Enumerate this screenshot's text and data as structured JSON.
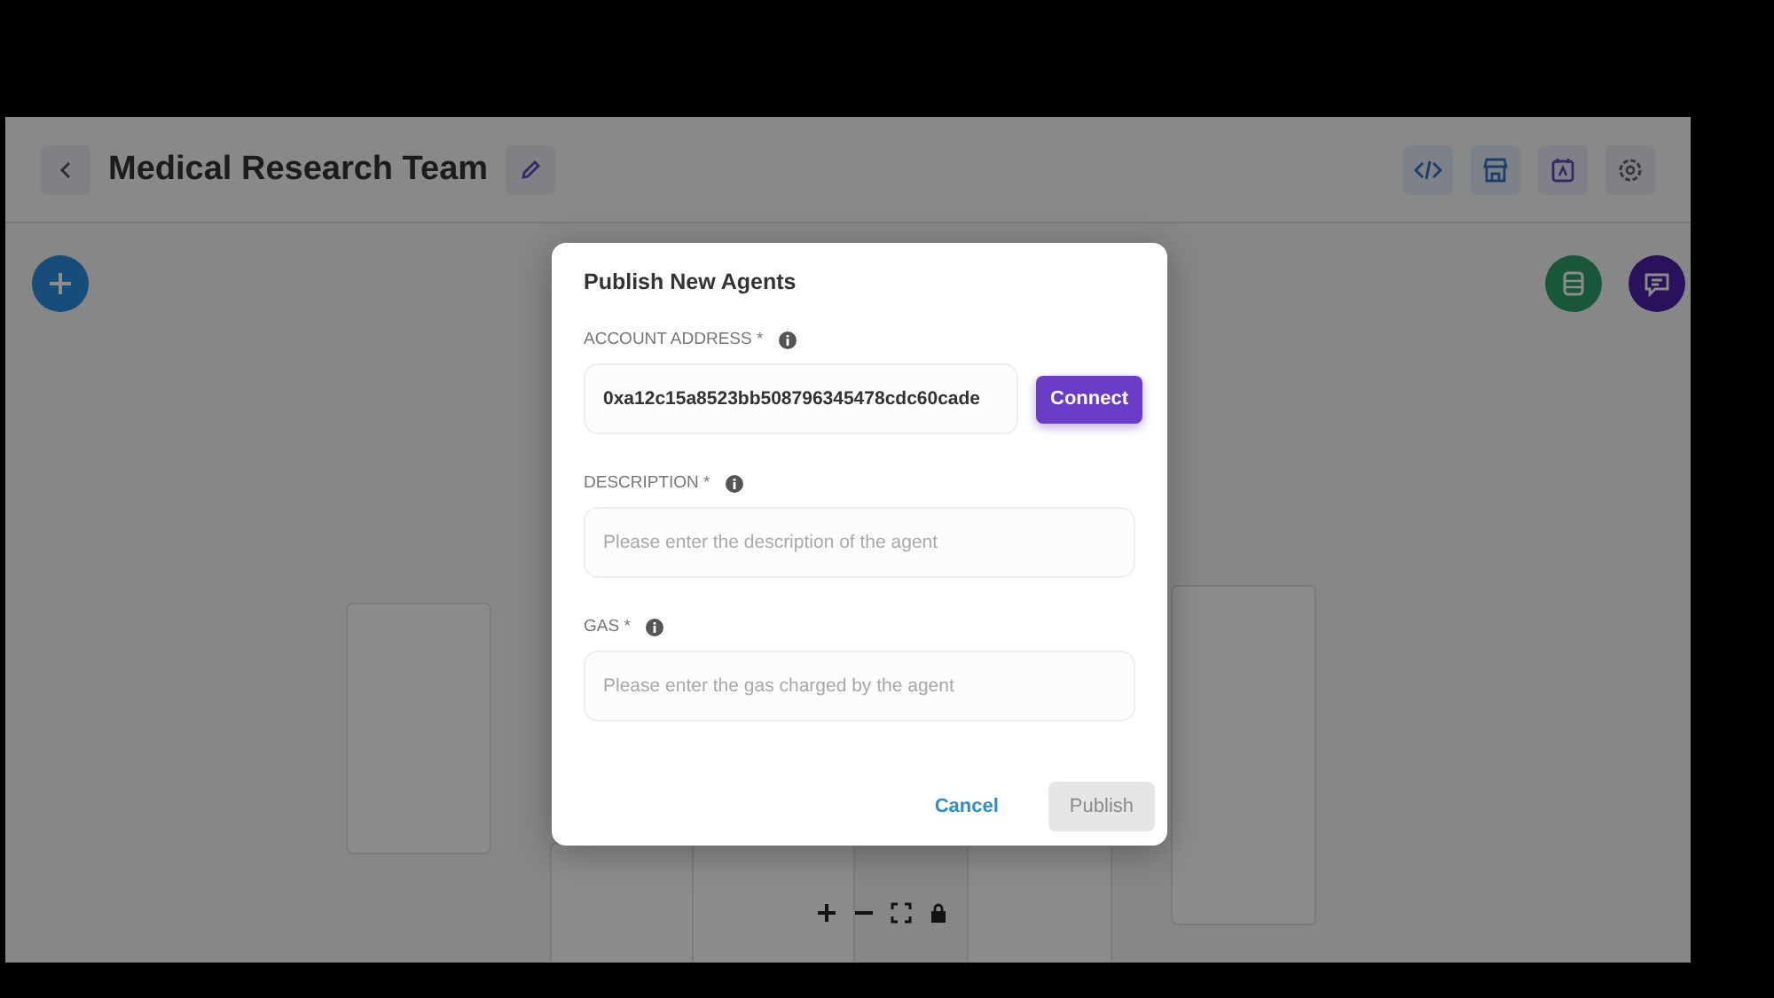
{
  "header": {
    "title": "Medical Research Team"
  },
  "dialog": {
    "title": "Publish New Agents",
    "fields": [
      {
        "kind": "address",
        "label": "ACCOUNT ADDRESS *",
        "value": "0xa12c15a8523bb508796345478cdc60cade",
        "button": "Connect"
      },
      {
        "kind": "text",
        "label": "DESCRIPTION *",
        "placeholder": "Please enter the description of the agent"
      },
      {
        "kind": "text",
        "label": "GAS *",
        "placeholder": "Please enter the gas charged by the agent"
      }
    ],
    "buttons": [
      {
        "label": "Cancel",
        "disabled": false
      },
      {
        "label": "Publish",
        "disabled": true
      }
    ]
  }
}
